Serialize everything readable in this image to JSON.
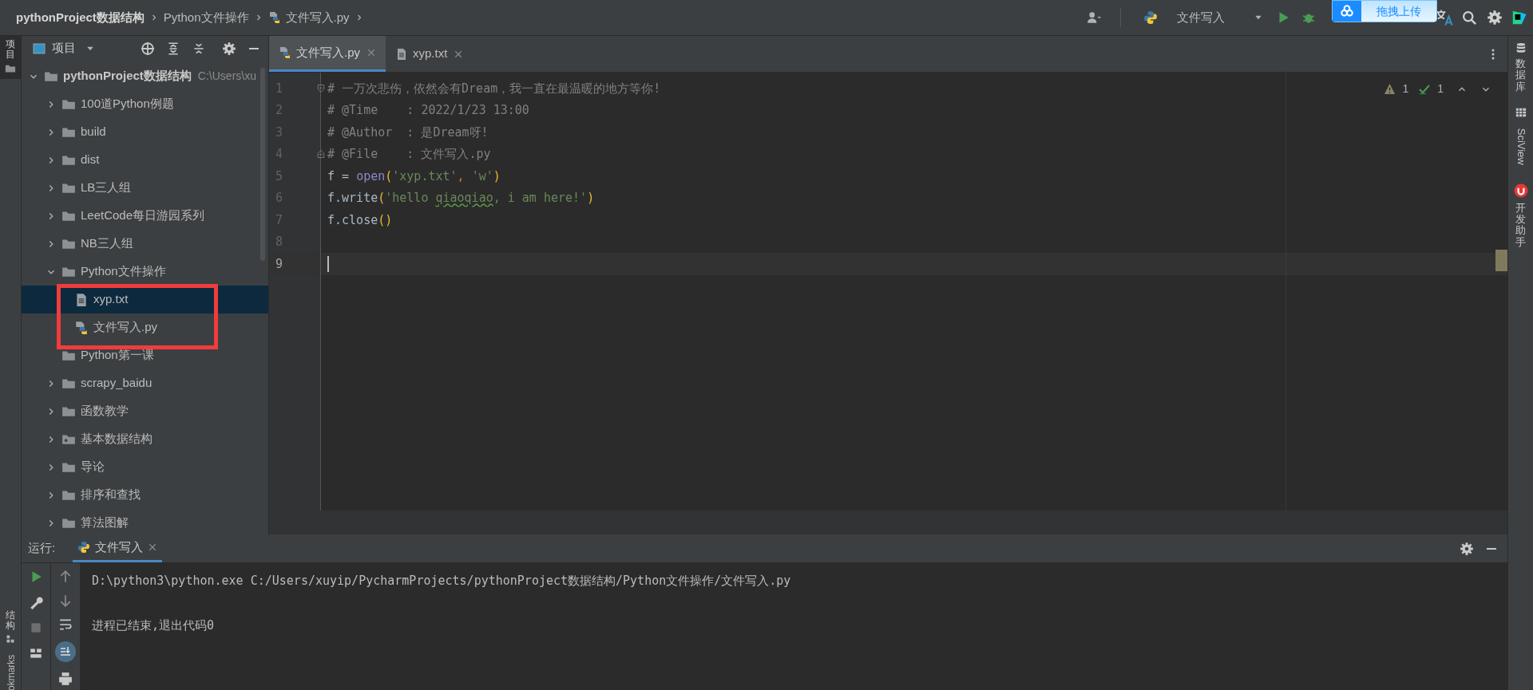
{
  "breadcrumbs": [
    {
      "label": "pythonProject数据结构",
      "kind": "project"
    },
    {
      "label": "Python文件操作",
      "kind": "folder"
    },
    {
      "label": "文件写入.py",
      "kind": "python_file"
    }
  ],
  "toolbar": {
    "run_config": "文件写入"
  },
  "upload_button": {
    "label": "拖拽上传"
  },
  "left_strip": [
    {
      "label": "项目",
      "kind": "project"
    },
    {
      "label": "结构",
      "kind": "structure"
    },
    {
      "label": "okmarks",
      "kind": "bookmarks"
    }
  ],
  "project_panel": {
    "title": "项目",
    "tree": [
      {
        "label": "pythonProject数据结构",
        "path": "C:\\Users\\xu",
        "kind": "folder",
        "expanded": true,
        "selected": false,
        "children": [
          {
            "label": "100道Python例题",
            "kind": "folder",
            "expanded": false,
            "selected": false
          },
          {
            "label": "build",
            "kind": "folder",
            "expanded": false,
            "selected": false
          },
          {
            "label": "dist",
            "kind": "folder",
            "expanded": false,
            "selected": false
          },
          {
            "label": "LB三人组",
            "kind": "folder",
            "expanded": false,
            "selected": false
          },
          {
            "label": "LeetCode每日游园系列",
            "kind": "folder",
            "expanded": false,
            "selected": false
          },
          {
            "label": "NB三人组",
            "kind": "folder",
            "expanded": false,
            "selected": false
          },
          {
            "label": "Python文件操作",
            "kind": "folder",
            "expanded": true,
            "selected": false,
            "children": [
              {
                "label": "xyp.txt",
                "kind": "text_file",
                "selected": true
              },
              {
                "label": "文件写入.py",
                "kind": "python_file",
                "selected": false
              }
            ]
          },
          {
            "label": "Python第一课",
            "kind": "empty_folder",
            "selected": false
          },
          {
            "label": "scrapy_baidu",
            "kind": "folder",
            "expanded": false,
            "selected": false
          },
          {
            "label": "函数教学",
            "kind": "folder",
            "expanded": false,
            "selected": false
          },
          {
            "label": "基本数据结构",
            "kind": "package",
            "expanded": false,
            "selected": false
          },
          {
            "label": "导论",
            "kind": "folder",
            "expanded": false,
            "selected": false
          },
          {
            "label": "排序和查找",
            "kind": "folder",
            "expanded": false,
            "selected": false
          },
          {
            "label": "算法图解",
            "kind": "folder",
            "expanded": false,
            "selected": false
          }
        ]
      }
    ]
  },
  "editor": {
    "tabs": [
      {
        "label": "文件写入.py",
        "kind": "python_file",
        "selected": true
      },
      {
        "label": "xyp.txt",
        "kind": "text_file",
        "selected": false
      }
    ],
    "inspections": {
      "warnings": "1",
      "passed": "1"
    },
    "lines": [
      {
        "number": "1",
        "fold_start": true,
        "current": false,
        "tokens": [
          {
            "text": "# 一万次悲伤，依然会有Dream，我一直在最温暖的地方等你!",
            "kind": "comment"
          }
        ]
      },
      {
        "number": "2",
        "current": false,
        "tokens": [
          {
            "text": "# @Time    : 2022/1/23 13:00",
            "kind": "comment"
          }
        ]
      },
      {
        "number": "3",
        "current": false,
        "tokens": [
          {
            "text": "# @Author  : 是Dream呀!",
            "kind": "comment"
          }
        ]
      },
      {
        "number": "4",
        "fold_end": true,
        "current": false,
        "tokens": [
          {
            "text": "# @File    : 文件写入.py",
            "kind": "comment"
          }
        ]
      },
      {
        "number": "5",
        "current": false,
        "tokens": [
          {
            "text": "f = ",
            "kind": "plain"
          },
          {
            "text": "open",
            "kind": "builtin"
          },
          {
            "text": "(",
            "kind": "paren"
          },
          {
            "text": "'xyp.txt'",
            "kind": "string"
          },
          {
            "text": ", ",
            "kind": "comma"
          },
          {
            "text": "'w'",
            "kind": "string"
          },
          {
            "text": ")",
            "kind": "paren"
          }
        ]
      },
      {
        "number": "6",
        "current": false,
        "tokens": [
          {
            "text": "f.write",
            "kind": "plain"
          },
          {
            "text": "(",
            "kind": "paren"
          },
          {
            "text": "'hello ",
            "kind": "string"
          },
          {
            "text": "qiaoqiao",
            "kind": "typo"
          },
          {
            "text": ", i am here!'",
            "kind": "string"
          },
          {
            "text": ")",
            "kind": "paren"
          }
        ]
      },
      {
        "number": "7",
        "current": false,
        "tokens": [
          {
            "text": "f.close",
            "kind": "plain"
          },
          {
            "text": "()",
            "kind": "paren"
          }
        ]
      },
      {
        "number": "8",
        "current": false
      },
      {
        "number": "9",
        "current": true
      }
    ]
  },
  "right_strip": [
    {
      "label": "数据库",
      "kind": "database"
    },
    {
      "label": "SciView",
      "kind": "sciview"
    },
    {
      "label": "开发助手",
      "kind": "assistant"
    }
  ],
  "run_panel": {
    "label": "运行:",
    "tab": "文件写入",
    "output": [
      "D:\\python3\\python.exe C:/Users/xuyip/PycharmProjects/pythonProject数据结构/Python文件操作/文件写入.py",
      "进程已结束,退出代码0"
    ]
  }
}
